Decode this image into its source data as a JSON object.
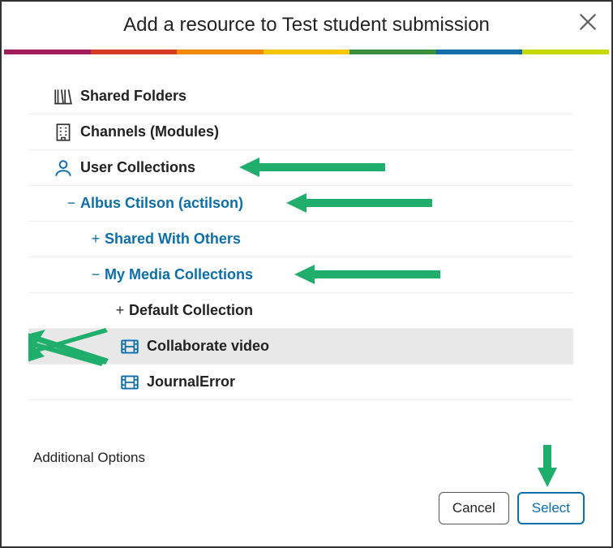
{
  "title": "Add a resource to Test student submission",
  "colorBar": [
    "#a01e5b",
    "#d63b26",
    "#f18a00",
    "#f7c600",
    "#3a8f3a",
    "#0d6ea8",
    "#c8d900"
  ],
  "tree": {
    "sharedFolders": "Shared Folders",
    "channels": "Channels (Modules)",
    "userCollections": "User Collections",
    "user": "Albus Ctilson (actilson)",
    "sharedWithOthers": "Shared With Others",
    "myMedia": "My Media Collections",
    "defaultCollection": "Default Collection",
    "collabVideo": "Collaborate video",
    "journalError": "JournalError"
  },
  "expanders": {
    "plus": "+",
    "minus": "−"
  },
  "additional": "Additional Options",
  "buttons": {
    "cancel": "Cancel",
    "select": "Select"
  }
}
